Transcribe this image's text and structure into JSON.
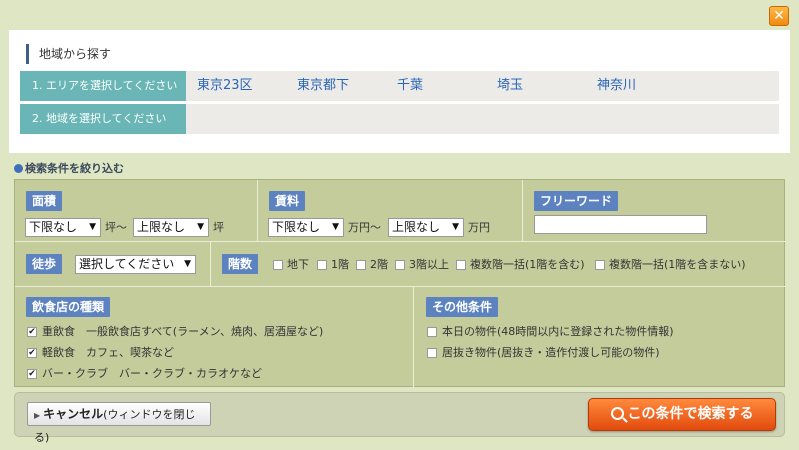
{
  "close_label": "✕",
  "area": {
    "heading": "地域から探す",
    "step1_label": "1. エリアを選択してください",
    "step2_label": "2. 地域を選択してください",
    "regions": [
      "東京23区",
      "東京都下",
      "千葉",
      "埼玉",
      "神奈川"
    ]
  },
  "filter_title": "検索条件を絞り込む",
  "size": {
    "label": "面積",
    "min_select": "下限なし",
    "min_unit": "坪～",
    "max_select": "上限なし",
    "max_unit": "坪"
  },
  "rent": {
    "label": "賃料",
    "min_select": "下限なし",
    "min_unit": "万円～",
    "max_select": "上限なし",
    "max_unit": "万円"
  },
  "freeword": {
    "label": "フリーワード",
    "value": ""
  },
  "walk": {
    "label": "徒歩",
    "select": "選択してください"
  },
  "floor": {
    "label": "階数",
    "options": [
      "地下",
      "1階",
      "2階",
      "3階以上",
      "複数階一括(1階を含む)",
      "複数階一括(1階を含まない)"
    ]
  },
  "restaurant": {
    "label": "飲食店の種類",
    "options": [
      {
        "text": "重飲食　一般飲食店すべて(ラーメン、焼肉、居酒屋など)",
        "checked": true
      },
      {
        "text": "軽飲食　カフェ、喫茶など",
        "checked": true
      },
      {
        "text": "バー・クラブ　バー・クラブ・カラオケなど",
        "checked": true
      }
    ]
  },
  "other": {
    "label": "その他条件",
    "options": [
      {
        "text": "本日の物件(48時間以内に登録された物件情報)",
        "checked": false
      },
      {
        "text": "居抜き物件(居抜き・造作付渡し可能の物件)",
        "checked": false
      }
    ]
  },
  "buttons": {
    "cancel_main": "キャンセル",
    "cancel_sub": "(ウィンドウを閉じる)",
    "search": "この条件で検索する"
  },
  "colors": {
    "tag_blue": "#5d82c0",
    "teal_label": "#6ab6b6",
    "region_link": "#2a66b8",
    "search_orange": "#e24a0e"
  }
}
